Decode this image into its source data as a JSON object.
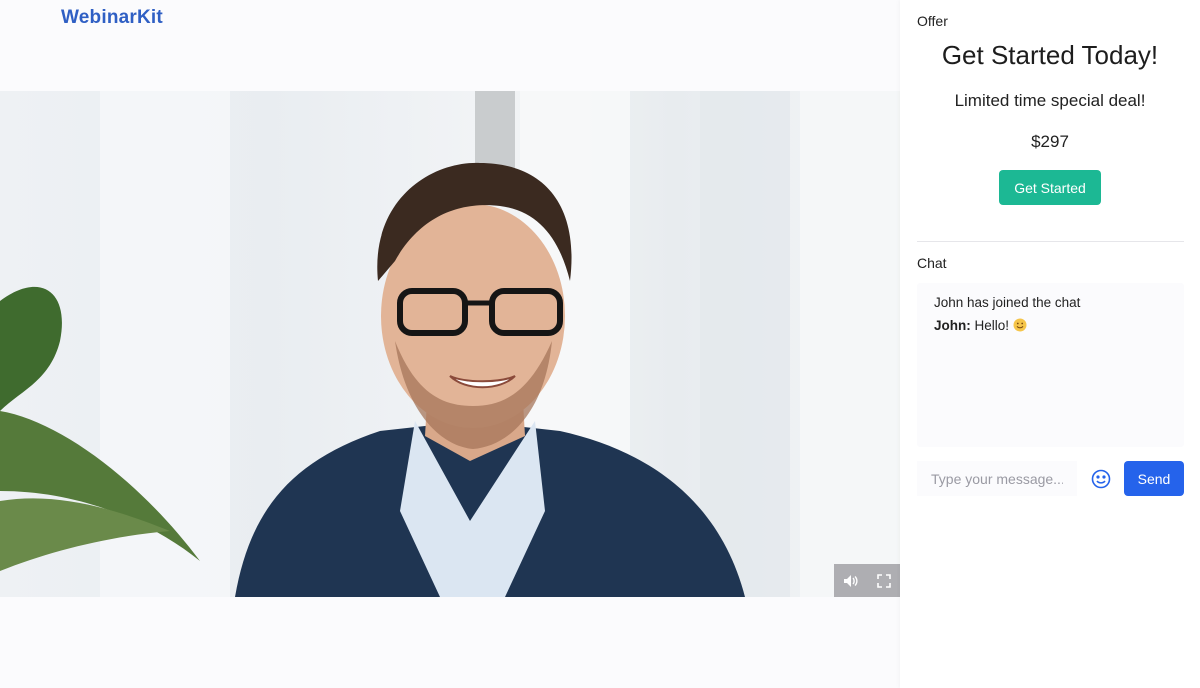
{
  "app": {
    "logo": "WebinarKit"
  },
  "video": {
    "controls": {
      "volume_icon": "volume-icon",
      "fullscreen_icon": "fullscreen-icon"
    }
  },
  "offer": {
    "section_label": "Offer",
    "title": "Get Started Today!",
    "subtitle": "Limited time special deal!",
    "price": "$297",
    "cta_label": "Get Started",
    "cta_color": "#1cb894"
  },
  "chat": {
    "section_label": "Chat",
    "messages": [
      {
        "text": "John has joined the chat"
      },
      {
        "author": "John:",
        "text": " Hello! "
      }
    ],
    "input_placeholder": "Type your message...",
    "emoji_icon": "smiley-icon",
    "send_label": "Send",
    "send_color": "#2563eb"
  },
  "colors": {
    "brand": "#2f5fc4"
  }
}
